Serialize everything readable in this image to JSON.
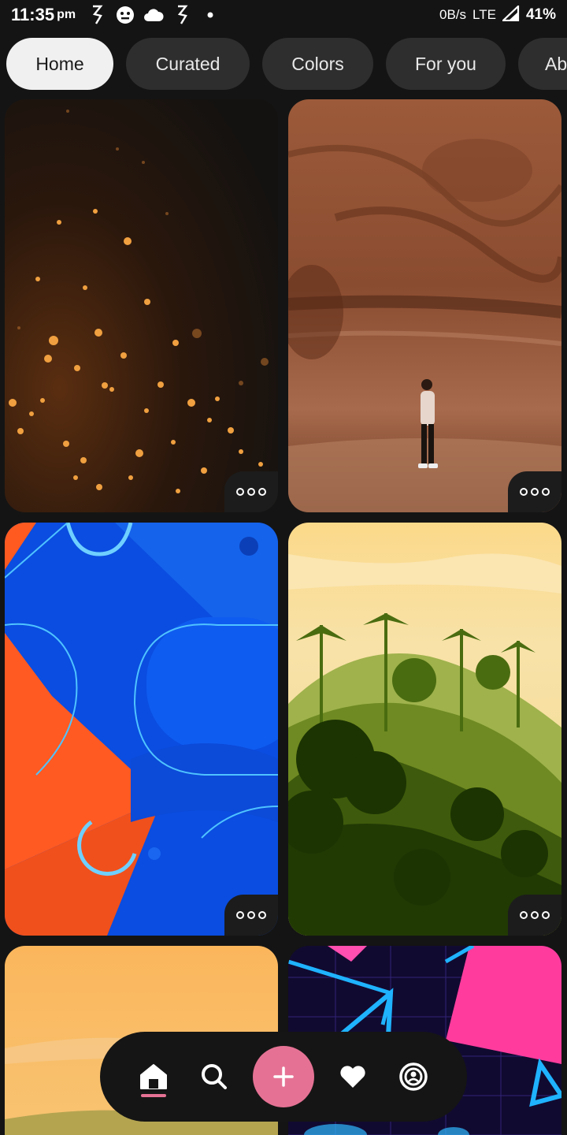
{
  "status_bar": {
    "time": "11:35",
    "ampm": "pm",
    "net_speed": "0B/s",
    "network": "LTE",
    "battery": "41%"
  },
  "tabs": [
    {
      "label": "Home",
      "active": true
    },
    {
      "label": "Curated",
      "active": false
    },
    {
      "label": "Colors",
      "active": false
    },
    {
      "label": "For you",
      "active": false
    },
    {
      "label": "Abstract",
      "active": false
    }
  ],
  "wallpapers": [
    {
      "description_icon": "bokeh-sparks-wallpaper"
    },
    {
      "description_icon": "canyon-person-wallpaper"
    },
    {
      "description_icon": "blue-orange-abstract-wallpaper"
    },
    {
      "description_icon": "jungle-silhouette-wallpaper"
    },
    {
      "description_icon": "orange-landscape-wallpaper"
    },
    {
      "description_icon": "neon-triangles-wallpaper"
    }
  ],
  "bottom_nav": {
    "items": [
      "home-icon",
      "search-icon",
      "add-icon",
      "heart-icon",
      "profile-icon"
    ],
    "accent": "#e57295"
  }
}
